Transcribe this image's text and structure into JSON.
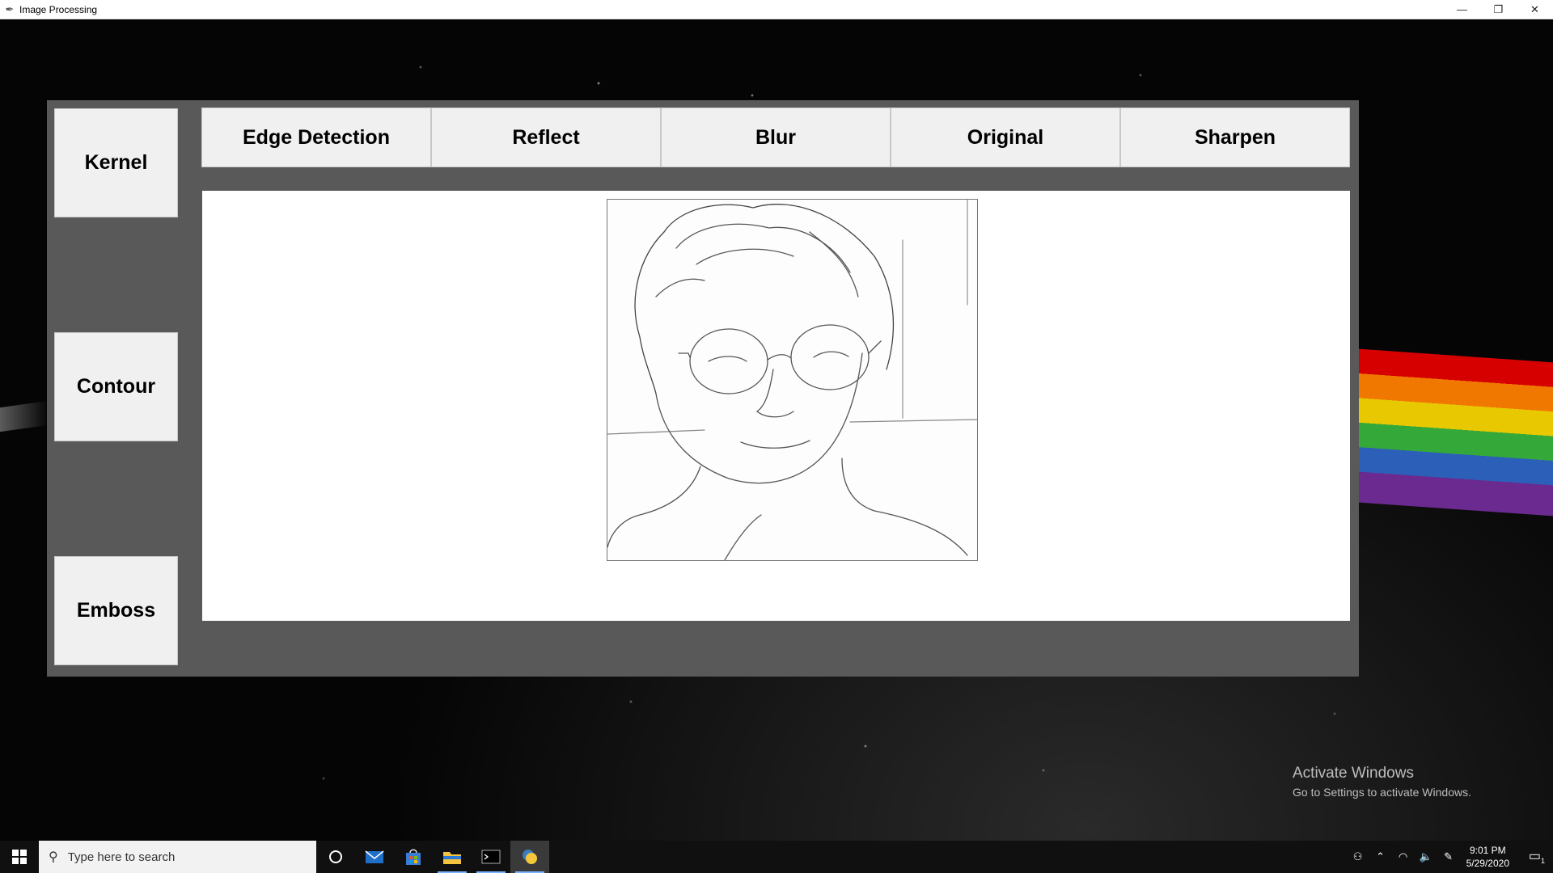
{
  "window": {
    "title": "Image Processing",
    "minimize_glyph": "—",
    "restore_glyph": "❐",
    "close_glyph": "✕"
  },
  "side_buttons": [
    {
      "label": "Kernel"
    },
    {
      "label": "Contour"
    },
    {
      "label": "Emboss"
    }
  ],
  "top_buttons": [
    {
      "label": "Edge Detection"
    },
    {
      "label": "Reflect"
    },
    {
      "label": "Blur"
    },
    {
      "label": "Original"
    },
    {
      "label": "Sharpen"
    }
  ],
  "image": {
    "icon": "sketch-portrait-image"
  },
  "watermark": {
    "line1": "Activate Windows",
    "line2": "Go to Settings to activate Windows."
  },
  "taskbar": {
    "search_placeholder": "Type here to search",
    "time": "9:01 PM",
    "date": "5/29/2020",
    "notification_count": "1"
  }
}
